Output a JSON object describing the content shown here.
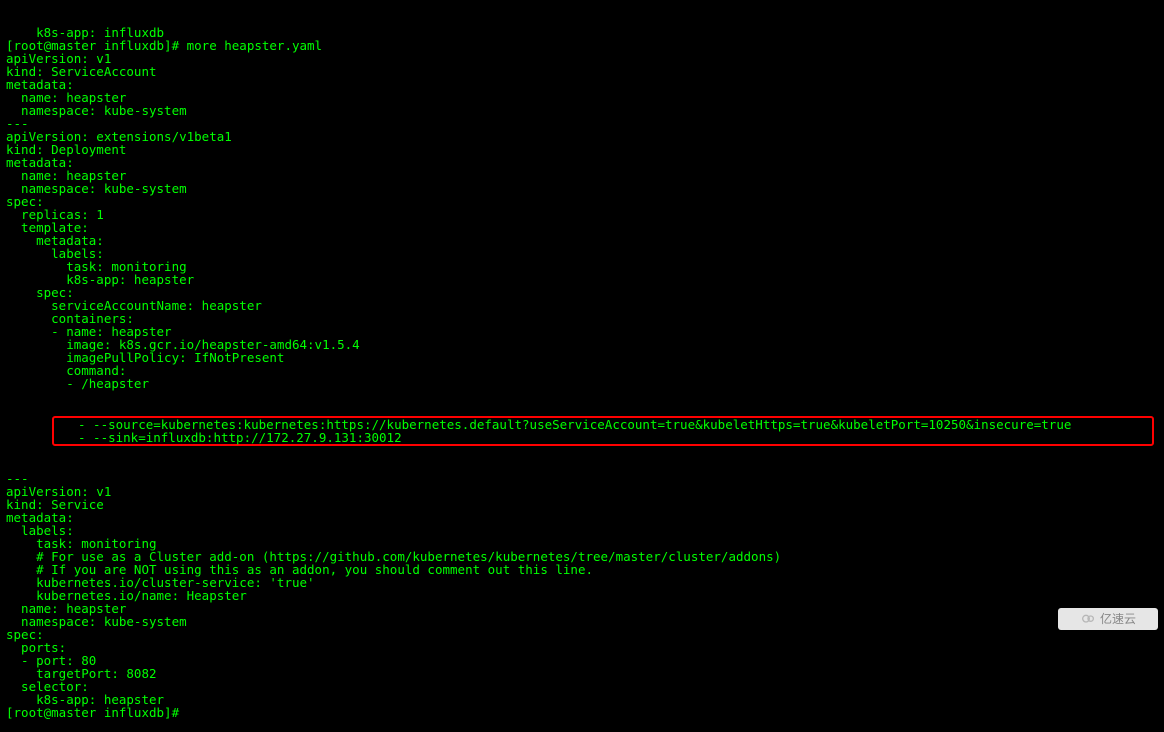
{
  "lines_top": [
    "    k8s-app: influxdb",
    "[root@master influxdb]# more heapster.yaml",
    "apiVersion: v1",
    "kind: ServiceAccount",
    "metadata:",
    "  name: heapster",
    "  namespace: kube-system",
    "---",
    "apiVersion: extensions/v1beta1",
    "kind: Deployment",
    "metadata:",
    "  name: heapster",
    "  namespace: kube-system",
    "spec:",
    "  replicas: 1",
    "  template:",
    "    metadata:",
    "      labels:",
    "        task: monitoring",
    "        k8s-app: heapster",
    "    spec:",
    "      serviceAccountName: heapster",
    "      containers:",
    "      - name: heapster",
    "        image: k8s.gcr.io/heapster-amd64:v1.5.4",
    "        imagePullPolicy: IfNotPresent",
    "        command:",
    "        - /heapster"
  ],
  "highlight_lines": [
    "- --source=kubernetes:kubernetes:https://kubernetes.default?useServiceAccount=true&kubeletHttps=true&kubeletPort=10250&insecure=true",
    "- --sink=influxdb:http://172.27.9.131:30012"
  ],
  "lines_bottom": [
    "---",
    "apiVersion: v1",
    "kind: Service",
    "metadata:",
    "  labels:",
    "    task: monitoring",
    "    # For use as a Cluster add-on (https://github.com/kubernetes/kubernetes/tree/master/cluster/addons)",
    "    # If you are NOT using this as an addon, you should comment out this line.",
    "    kubernetes.io/cluster-service: 'true'",
    "    kubernetes.io/name: Heapster",
    "  name: heapster",
    "  namespace: kube-system",
    "spec:",
    "  ports:",
    "  - port: 80",
    "    targetPort: 8082",
    "  selector:",
    "    k8s-app: heapster",
    "[root@master influxdb]#"
  ],
  "watermark_text": "亿速云"
}
